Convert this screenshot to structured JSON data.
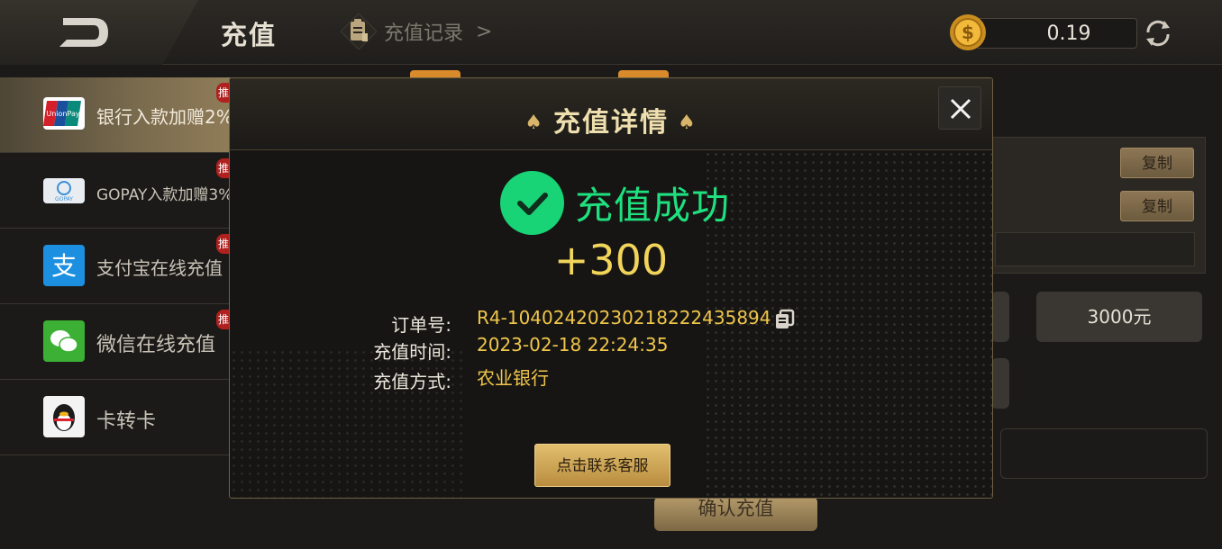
{
  "header": {
    "title": "充值",
    "record_link": "充值记录",
    "record_arrow": ">",
    "balance": "0.19"
  },
  "sidebar": {
    "items": [
      {
        "label": "银行入款加赠2%",
        "icon": "unionpay-icon",
        "active": true
      },
      {
        "label": "GOPAY入款加赠3%",
        "icon": "gopay-icon",
        "active": false
      },
      {
        "label": "支付宝在线充值",
        "icon": "alipay-icon",
        "active": false
      },
      {
        "label": "微信在线充值",
        "icon": "wechat-icon",
        "active": false
      },
      {
        "label": "卡转卡",
        "icon": "qq-penguin-icon",
        "active": false
      }
    ],
    "badge": "推"
  },
  "background": {
    "copy_labels": [
      "复制",
      "复制"
    ],
    "amount_option": "3000元",
    "confirm_label": "确认充值"
  },
  "modal": {
    "title": "充值详情",
    "status": "充值成功",
    "amount": "+300",
    "order_label": "订单号:",
    "order_value": "R4-1040242023021822243 5894",
    "time_label": "充值时间:",
    "time_value": "2023-02-18 22:24:35",
    "method_label": "充值方式:",
    "method_value": "农业银行",
    "service_button": "点击联系客服"
  },
  "colors": {
    "accent_gold": "#f0c64a",
    "success_green": "#1fe07e",
    "brand_dark": "#161513"
  }
}
